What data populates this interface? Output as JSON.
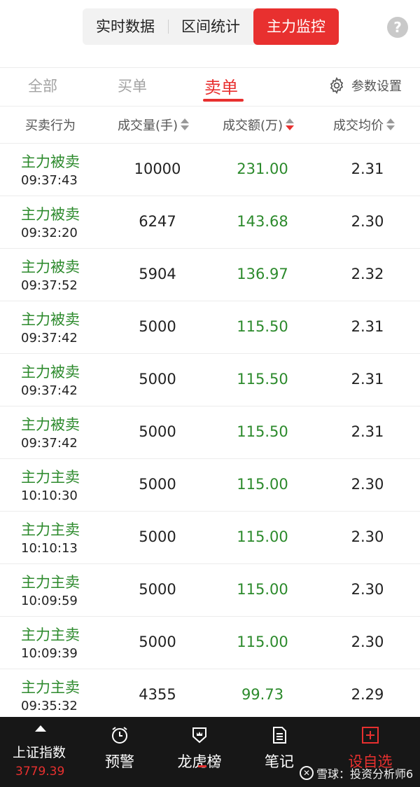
{
  "top_tabs": [
    {
      "label": "实时数据"
    },
    {
      "label": "区间统计"
    },
    {
      "label": "主力监控"
    }
  ],
  "help_icon": "?",
  "sub_tabs": [
    {
      "label": "全部"
    },
    {
      "label": "买单"
    },
    {
      "label": "卖单"
    }
  ],
  "settings_label": "参数设置",
  "columns": [
    {
      "label": "买卖行为"
    },
    {
      "label": "成交量(手)"
    },
    {
      "label": "成交额(万)"
    },
    {
      "label": "成交均价"
    }
  ],
  "rows": [
    {
      "action": "主力被卖",
      "time": "09:37:43",
      "volume": "10000",
      "amount": "231.00",
      "avg_price": "2.31"
    },
    {
      "action": "主力被卖",
      "time": "09:32:20",
      "volume": "6247",
      "amount": "143.68",
      "avg_price": "2.30"
    },
    {
      "action": "主力被卖",
      "time": "09:37:52",
      "volume": "5904",
      "amount": "136.97",
      "avg_price": "2.32"
    },
    {
      "action": "主力被卖",
      "time": "09:37:42",
      "volume": "5000",
      "amount": "115.50",
      "avg_price": "2.31"
    },
    {
      "action": "主力被卖",
      "time": "09:37:42",
      "volume": "5000",
      "amount": "115.50",
      "avg_price": "2.31"
    },
    {
      "action": "主力被卖",
      "time": "09:37:42",
      "volume": "5000",
      "amount": "115.50",
      "avg_price": "2.31"
    },
    {
      "action": "主力主卖",
      "time": "10:10:30",
      "volume": "5000",
      "amount": "115.00",
      "avg_price": "2.30"
    },
    {
      "action": "主力主卖",
      "time": "10:10:13",
      "volume": "5000",
      "amount": "115.00",
      "avg_price": "2.30"
    },
    {
      "action": "主力主卖",
      "time": "10:09:59",
      "volume": "5000",
      "amount": "115.00",
      "avg_price": "2.30"
    },
    {
      "action": "主力主卖",
      "time": "10:09:39",
      "volume": "5000",
      "amount": "115.00",
      "avg_price": "2.30"
    },
    {
      "action": "主力主卖",
      "time": "09:35:32",
      "volume": "4355",
      "amount": "99.73",
      "avg_price": "2.29"
    }
  ],
  "index": {
    "name": "上证指数",
    "value": "3779.39"
  },
  "nav": [
    {
      "label": "预警",
      "icon": "alarm-clock-icon"
    },
    {
      "label": "龙虎榜",
      "icon": "crown-shield-icon"
    },
    {
      "label": "笔记",
      "icon": "note-icon"
    },
    {
      "label": "设自选",
      "icon": "plus-square-icon"
    }
  ],
  "watermark": "雪球：投资分析师6",
  "colors": {
    "accent": "#e8302f",
    "sell_green": "#2c8a2c",
    "nav_bg": "#171717"
  }
}
